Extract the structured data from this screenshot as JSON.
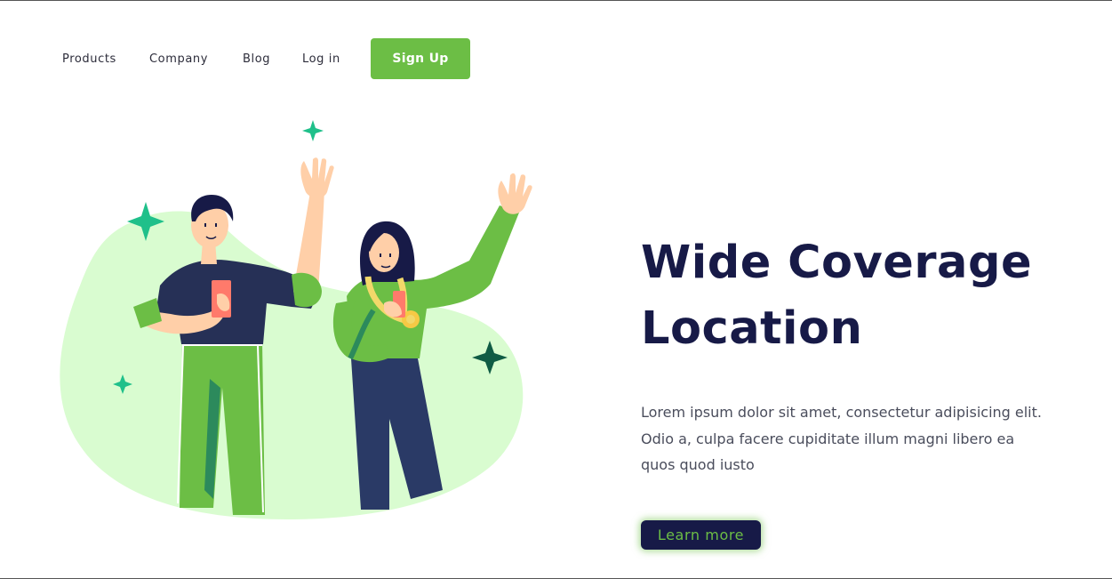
{
  "nav": {
    "items": [
      {
        "label": "Products"
      },
      {
        "label": "Company"
      },
      {
        "label": "Blog"
      },
      {
        "label": "Log in"
      }
    ],
    "signup_label": "Sign Up"
  },
  "hero": {
    "title_line1": "Wide Coverage",
    "title_line2": "Location",
    "description": "Lorem ipsum dolor sit amet, consectetur adipisicing elit. Odio a, culpa facere cupiditate illum magni libero ea quos quod iusto",
    "cta_label": "Learn more"
  },
  "colors": {
    "brand_green": "#6cbe45",
    "navy": "#171a47",
    "blob": "#d9fcd0",
    "sparkle": "#1fc08a",
    "sparkle_dark": "#0f5b44"
  }
}
